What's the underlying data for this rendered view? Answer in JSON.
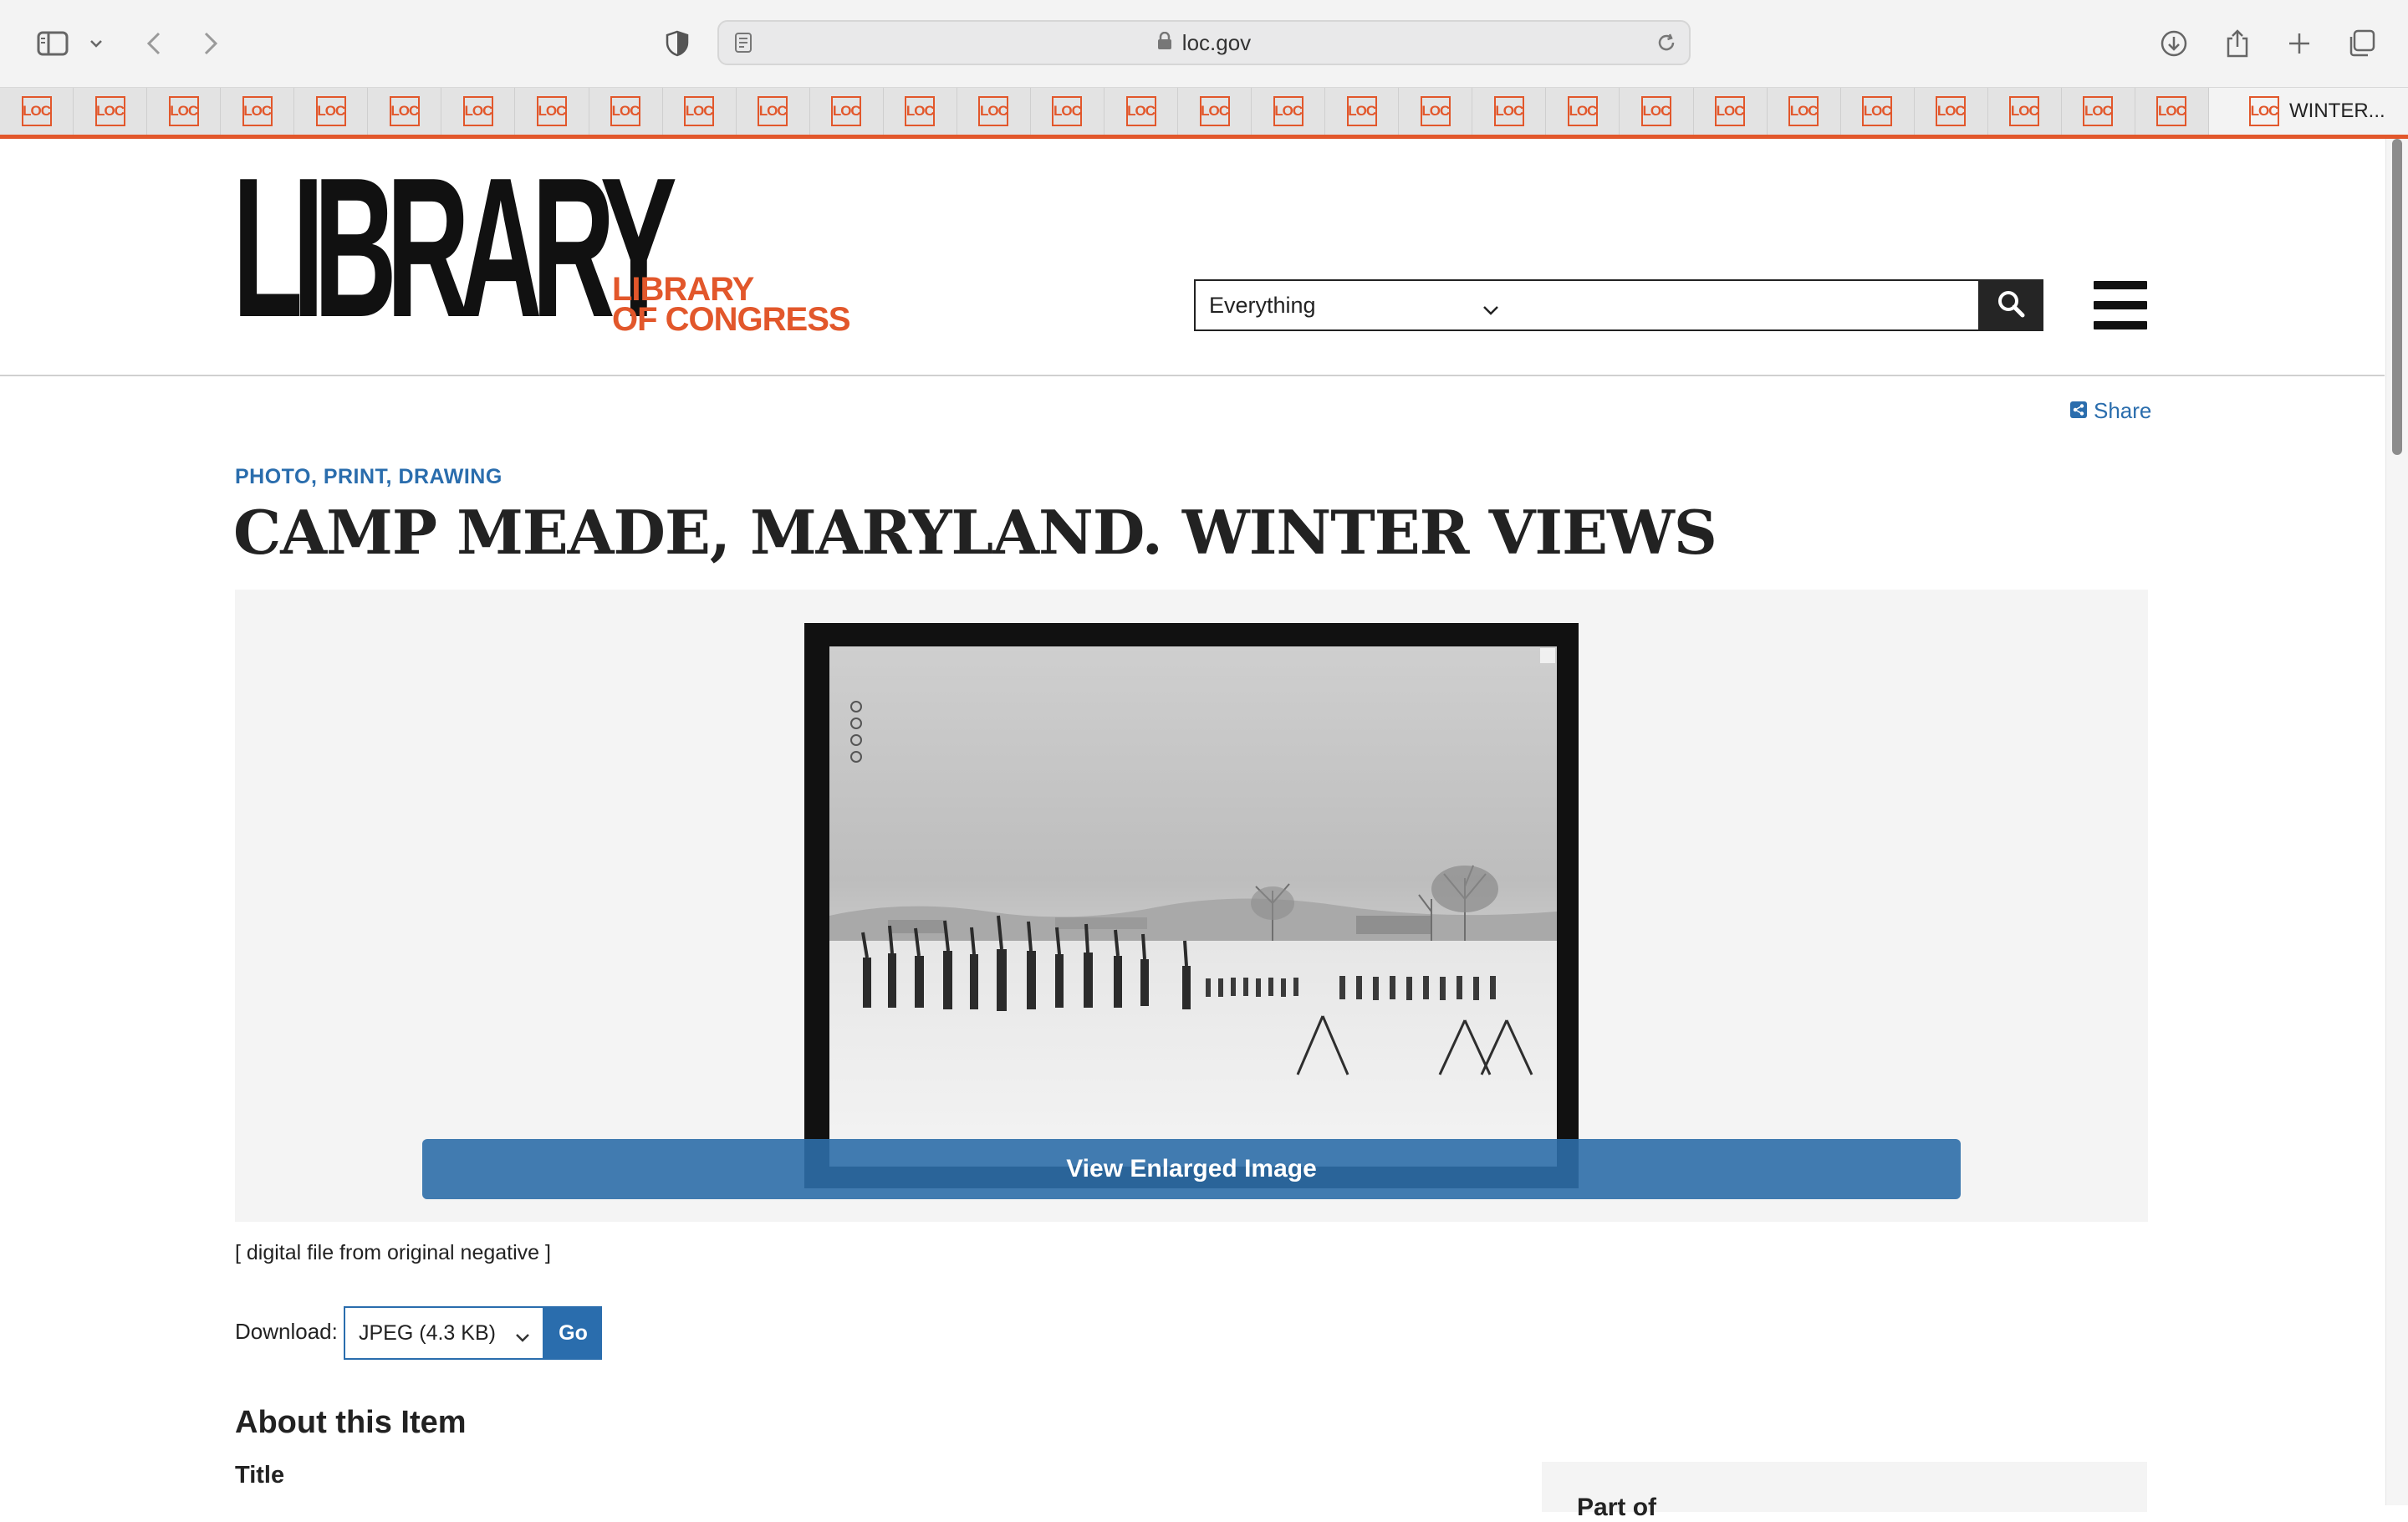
{
  "browser": {
    "url": "loc.gov",
    "pinned_tab_label": "LOC",
    "pinned_tab_count": 30,
    "active_tab_title": "WINTER...",
    "accent_color": "#e2572b"
  },
  "site": {
    "logo_main": "LIBRARY",
    "logo_sub_line1": "LIBRARY",
    "logo_sub_line2": "OF CONGRESS",
    "search_scope": "Everything",
    "search_placeholder": "",
    "brand_color": "#e2572b",
    "link_color": "#2a6dad"
  },
  "item": {
    "share_label": "Share",
    "category": "PHOTO, PRINT, DRAWING",
    "title": "CAMP MEADE, MARYLAND. WINTER VIEWS",
    "enlarge_label": "View Enlarged Image",
    "caption": "[ digital file from original negative ]",
    "download_label": "Download:",
    "download_option": "JPEG (4.3 KB)",
    "download_go": "Go",
    "about_heading": "About this Item",
    "field_title_label": "Title",
    "sidebar_heading_partial": "Part of"
  }
}
